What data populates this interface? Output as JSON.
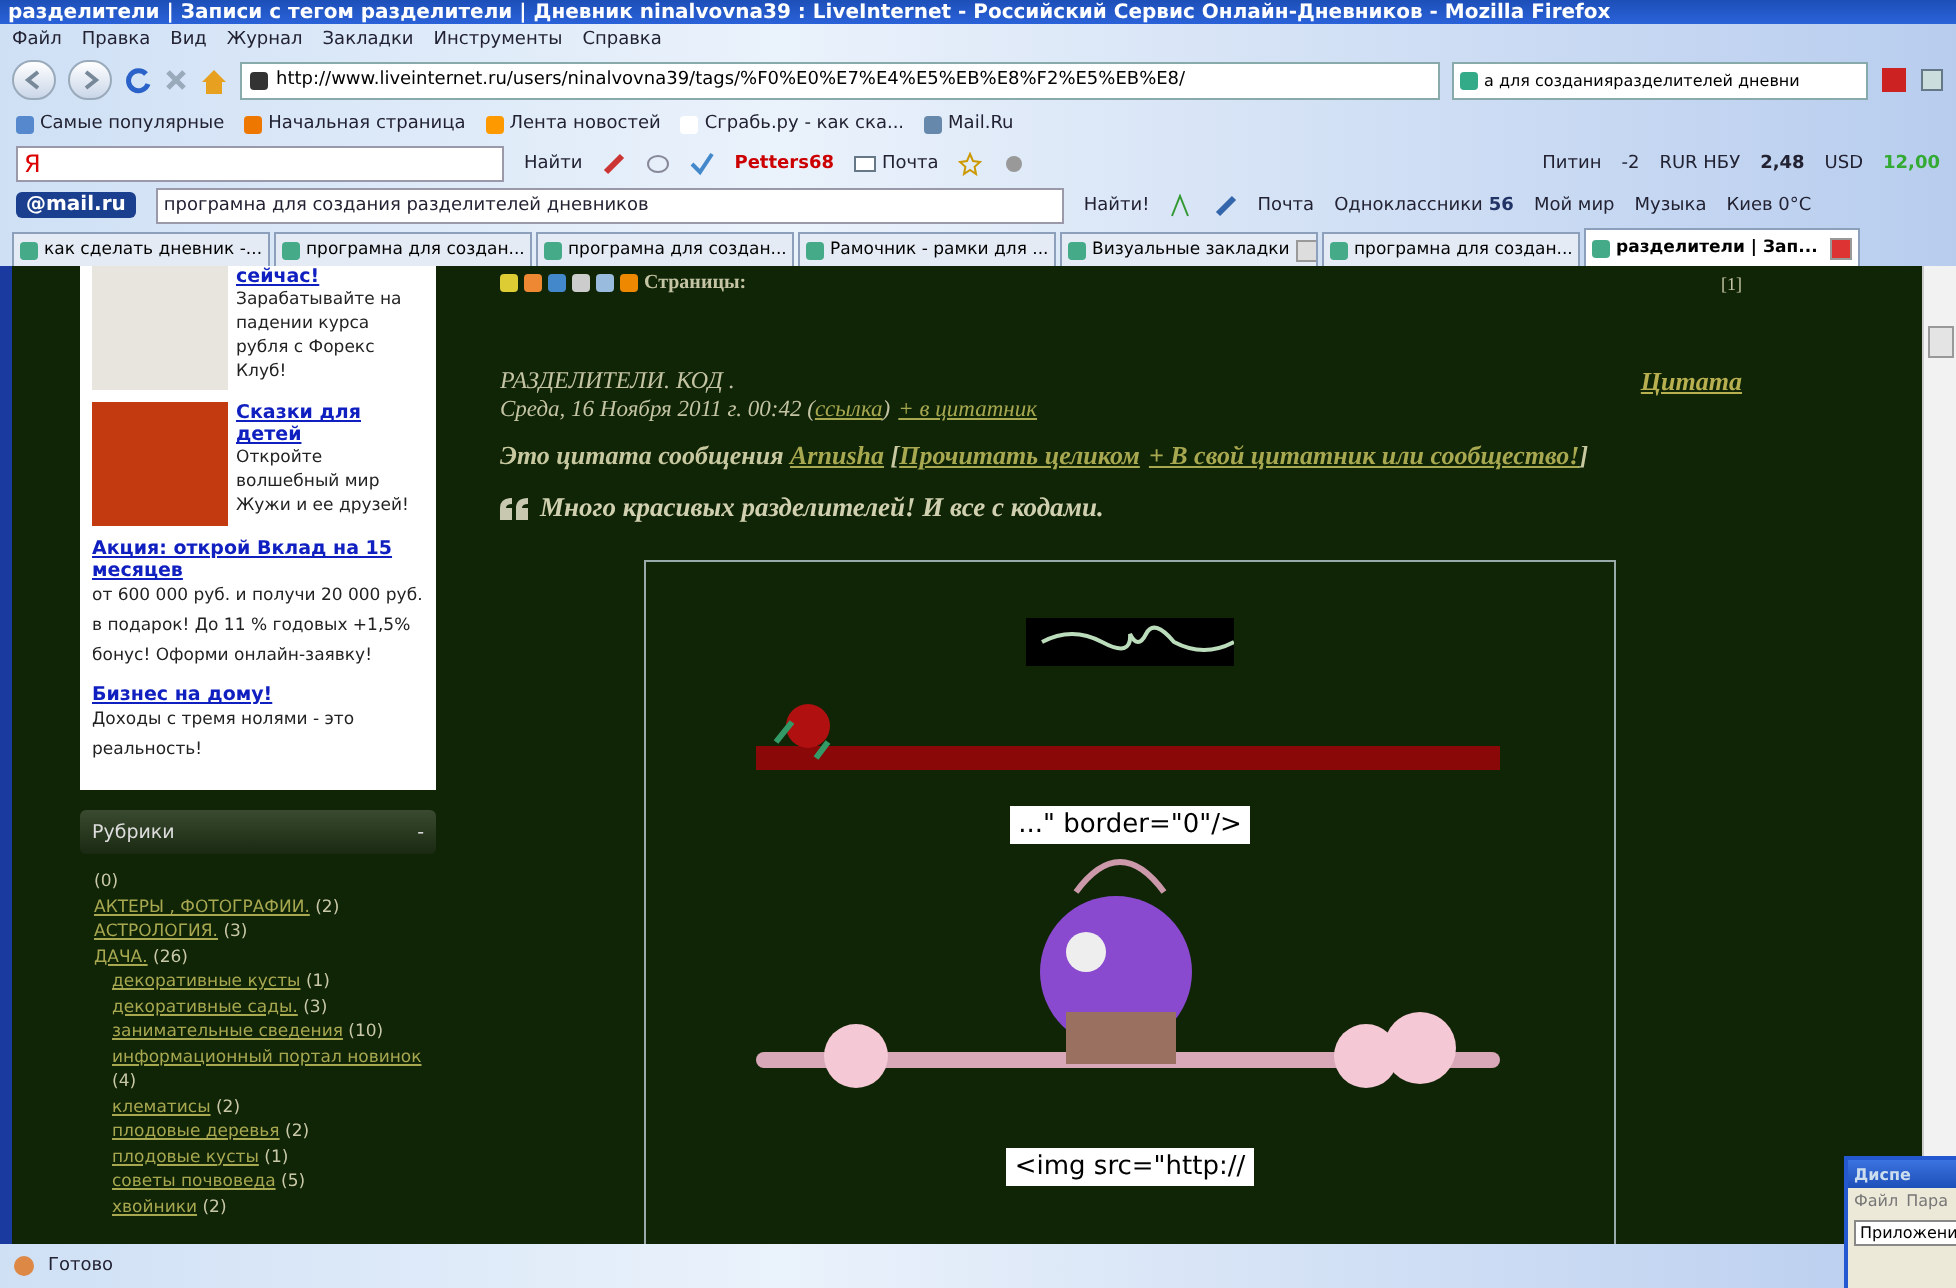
{
  "window": {
    "title": "разделители | Записи с тегом разделители | Дневник ninalvovna39 : LiveInternet - Российский Сервис Онлайн-Дневников - Mozilla Firefox"
  },
  "menu": [
    "Файл",
    "Правка",
    "Вид",
    "Журнал",
    "Закладки",
    "Инструменты",
    "Справка"
  ],
  "address_bar": {
    "value": "http://www.liveinternet.ru/users/ninalvovna39/tags/%F0%E0%E7%E4%E5%EB%E8%F2%E5%EB%E8/"
  },
  "search_box": {
    "value": "а для созданияразделителей дневни"
  },
  "bookmarks": [
    "Самые популярные",
    "Начальная страница",
    "Лента новостей",
    "Сграбь.ру - как ска...",
    "Mail.Ru"
  ],
  "yandex_bar": {
    "logo": "Я",
    "search_button": "Найти",
    "user": "Petters68",
    "mail": "Почта",
    "city": "Питин",
    "temperature": "-2",
    "rate_label": "RUR НБУ",
    "rate_value": "2,48",
    "usd_label": "USD",
    "usd_value": "12,00"
  },
  "mailru_bar": {
    "logo": "@mail.ru",
    "query": "програмна для создания разделителей дневников",
    "search_button": "Найти!",
    "links": [
      {
        "label": "Почта"
      },
      {
        "label": "Одноклассники",
        "count": "56"
      },
      {
        "label": "Мой мир"
      },
      {
        "label": "Музыка"
      },
      {
        "label": "Киев 0°C"
      }
    ]
  },
  "tabs": [
    {
      "label": "как сделать дневник -...",
      "selected": false
    },
    {
      "label": "програмна для создан...",
      "selected": false
    },
    {
      "label": "програмна для создан...",
      "selected": false
    },
    {
      "label": "Рамочник - рамки для ...",
      "selected": false
    },
    {
      "label": "Визуальные закладки",
      "selected": false
    },
    {
      "label": "програмна для создан...",
      "selected": false
    },
    {
      "label": "разделители | Зап...",
      "selected": true
    }
  ],
  "sidebar": {
    "ads": [
      {
        "title": "сейчас!",
        "text": "Зарабатывайте на падении курса рубля с Форекс Клуб!",
        "kind": "image"
      },
      {
        "title": "Сказки для детей",
        "text": "Откройте волшебный мир Жужи и ее друзей!",
        "kind": "image"
      },
      {
        "title": "Акция: открой Вклад на 15 месяцев",
        "text": "от 600 000 руб. и получи 20 000 руб. в подарок! До 11 % годовых +1,5% бонус! Оформи онлайн-заявку!",
        "kind": "text"
      },
      {
        "title": "Бизнес на дому!",
        "text": "Доходы с тремя нолями - это реальность!",
        "kind": "text"
      }
    ],
    "rubrics": {
      "title": "Рубрики",
      "toggle": "-",
      "items": [
        {
          "count": "(0)"
        },
        {
          "name": "АКТЕРЫ , ФОТОГРАФИИ.",
          "count": "(2)"
        },
        {
          "name": "АСТРОЛОГИЯ.",
          "count": "(3)"
        },
        {
          "name": "ДАЧА.",
          "count": "(26)",
          "children": [
            {
              "name": "декоративные кусты",
              "count": "(1)"
            },
            {
              "name": "декоративные сады.",
              "count": "(3)"
            },
            {
              "name": "занимательные сведения",
              "count": "(10)"
            },
            {
              "name": "информационный портал новинок",
              "count": "(4)"
            },
            {
              "name": "клематисы",
              "count": "(2)"
            },
            {
              "name": "плодовые деревья",
              "count": "(2)"
            },
            {
              "name": "плодовые кусты",
              "count": "(1)"
            },
            {
              "name": "советы почвоведа",
              "count": "(5)"
            },
            {
              "name": "хвойники",
              "count": "(2)"
            }
          ]
        }
      ]
    }
  },
  "post": {
    "pages_label": "Страницы:",
    "pages": "[1]",
    "title": "РАЗДЕЛИТЕЛИ. КОД .",
    "category": "Цитата",
    "date": [
      {
        "text": "Среда, 16 Ноября 2011 г. 00:42 (",
        "link": false
      },
      {
        "text": "ссылка",
        "link": true
      },
      {
        "text": ")",
        "link": false
      },
      {
        "text": "+ в цитатник",
        "link": true
      }
    ],
    "intro": [
      {
        "text": "Это цитата сообщения ",
        "link": false
      },
      {
        "text": "Arnusha",
        "link": true
      },
      {
        "text": " [",
        "link": false
      },
      {
        "text": "Прочитать целиком",
        "link": true
      },
      {
        "text": "+ В свой цитатник или сообщество!",
        "link": true
      },
      {
        "text": "]",
        "link": false
      }
    ],
    "quote": "Много красивых разделителей! И все с кодами.",
    "code_snippets": [
      "...\" border=\"0\"/>",
      "<img src=\"http://"
    ]
  },
  "status_bar": {
    "text": "Готово"
  },
  "task_window": {
    "title": "Диспе",
    "menu": [
      "Файл",
      "Пара"
    ],
    "tab": "Приложени"
  }
}
